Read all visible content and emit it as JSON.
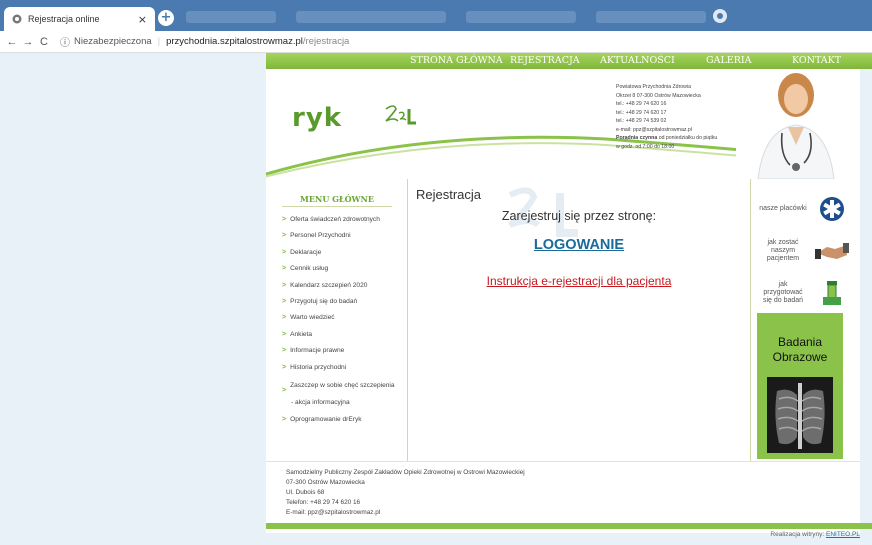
{
  "browser": {
    "tab_title": "Rejestracja online",
    "tab_close": "×",
    "new_tab": "+",
    "back": "←",
    "forward": "→",
    "reload": "C",
    "info_icon": "ⓘ",
    "insecure_label": "Niezabezpieczona",
    "separator": "|",
    "url_host": "przychodnia.szpitalostrowmaz.pl",
    "url_path": "/rejestracja"
  },
  "nav": {
    "items": [
      "STRONA GŁÓWNA",
      "REJESTRACJA",
      "AKTUALNOŚCI",
      "GALERIA",
      "KONTAKT"
    ]
  },
  "header": {
    "logo_text": "ryk",
    "contact_lines": [
      "Powiatowa Przychodnia Zdrowia",
      "Okrzei 8 07-300 Ostrów Mazowiecka",
      "tel.: +48 29 74 620 16",
      "tel.: +48 29 74 620 17",
      "tel.: +48 29 74 539 02",
      "e-mail: ppz@szpitalostrowmaz.pl"
    ],
    "hours_bold": "Poradnia czynna",
    "hours_rest": "od poniedziałku do piątku",
    "hours_line2": "w godz. od 7:00 do 18:00"
  },
  "sidebar": {
    "title": "MENU GŁÓWNE",
    "items": [
      "Oferta świadczeń zdrowotnych",
      "Personel Przychodni",
      "Deklaracje",
      "Cennik usług",
      "Kalendarz szczepień 2020",
      "Przygotuj się do badań",
      "Warto wiedzieć",
      "Ankieta",
      "Informacje prawne",
      "Historia przychodni",
      "Zaszczep w sobie chęć szczepienia",
      "- akcja informacyjna",
      "Oprogramowanie drEryk"
    ]
  },
  "content": {
    "title": "Rejestracja",
    "register_text": "Zarejestruj się przez stronę:",
    "login_link": "LOGOWANIE",
    "instruction_link": "Instrukcja e-rejestracji dla pacjenta"
  },
  "right_panel": {
    "items": [
      {
        "label": "nasze placówki",
        "icon": "star-of-life-icon"
      },
      {
        "label": "jak zostać naszym pacjentem",
        "icon": "handshake-icon"
      },
      {
        "label": "jak przygotować się do badań",
        "icon": "test-tubes-icon"
      }
    ],
    "banner_title_1": "Badania",
    "banner_title_2": "Obrazowe"
  },
  "footer": {
    "lines": [
      "Samodzielny Publiczny Zespół Zakładów Opieki Zdrowotnej w Ostrowi Mazowieckiej",
      "07-300 Ostrów Mazowiecka",
      "Ul. Dubois 68",
      "Telefon: +48 29 74 620 16",
      "E-mail: ppz@szpitalostrowmaz.pl"
    ],
    "credits_prefix": "Realizacja witryny:",
    "credits_link": "ENITEO.PL"
  },
  "colors": {
    "green": "#8bc34a",
    "nav_green": "#7fb539",
    "link_blue": "#1a6a9a",
    "link_red": "#c9181e",
    "tabbar_blue": "#4a7ab0"
  }
}
